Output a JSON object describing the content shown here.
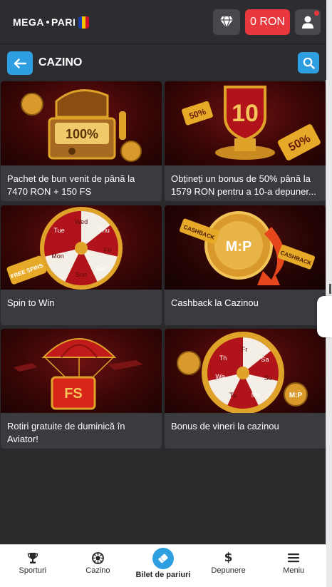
{
  "header": {
    "logo_left": "MEGA",
    "logo_right": "PARI",
    "flag_colors": [
      "#1b3fa6",
      "#f5c400",
      "#d0102b"
    ],
    "balance_label": "0 RON",
    "icons": [
      "diamond-icon",
      "user-icon"
    ]
  },
  "section": {
    "title": "CAZINO",
    "icons": [
      "back-arrow-icon",
      "search-icon"
    ]
  },
  "promos": [
    {
      "label": "Pachet de bun venit de până la 7470 RON + 150 FS",
      "art_text": "100%"
    },
    {
      "label": "Obțineți un bonus de 50% până la 1579 RON pentru a 10-a depuner...",
      "art_text": "10",
      "art_badges": [
        "50%",
        "50%"
      ]
    },
    {
      "label": "Spin to Win",
      "art_days": [
        "Wed",
        "Thu",
        "Fri",
        "Sat",
        "Sun",
        "Mon",
        "Tue"
      ],
      "art_badge": "FREE SPINS"
    },
    {
      "label": "Cashback la Cazinou",
      "art_text": "M:P",
      "art_badges": [
        "CASHBACK",
        "CASHBACK"
      ]
    },
    {
      "label": "Rotiri gratuite de duminică în Aviator!",
      "art_text": "FS"
    },
    {
      "label": "Bonus de vineri la cazinou",
      "art_days": [
        "Fr",
        "Sa",
        "Su",
        "Mo",
        "Tu",
        "We",
        "Th"
      ],
      "art_badge": "M:P"
    }
  ],
  "bottom_nav": [
    {
      "label": "Sporturi",
      "icon": "trophy-icon"
    },
    {
      "label": "Cazino",
      "icon": "casino-chip-icon"
    },
    {
      "label": "Bilet de pariuri",
      "icon": "ticket-icon",
      "active": true
    },
    {
      "label": "Depunere",
      "icon": "dollar-icon"
    },
    {
      "label": "Meniu",
      "icon": "menu-icon"
    }
  ],
  "colors": {
    "accent": "#2d9ee0",
    "balance": "#e8383d",
    "background": "#2a2a2d",
    "card": "#3a3a3f",
    "promo_red": "#6b1111",
    "gold": "#e0a32a"
  }
}
